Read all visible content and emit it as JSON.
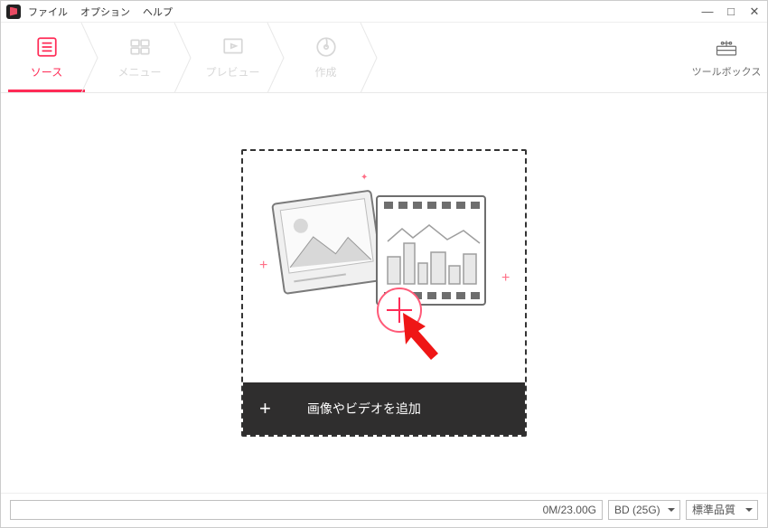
{
  "menubar": {
    "file": "ファイル",
    "option": "オプション",
    "help": "ヘルプ"
  },
  "tabs": {
    "source": "ソース",
    "menu": "メニュー",
    "preview": "プレビュー",
    "create": "作成"
  },
  "toolbox": {
    "label": "ツールボックス"
  },
  "dropzone": {
    "add_label": "画像やビデオを追加"
  },
  "status": {
    "size_text": "0M/23.00G",
    "disc_type": "BD (25G)",
    "quality": "標準品質"
  }
}
